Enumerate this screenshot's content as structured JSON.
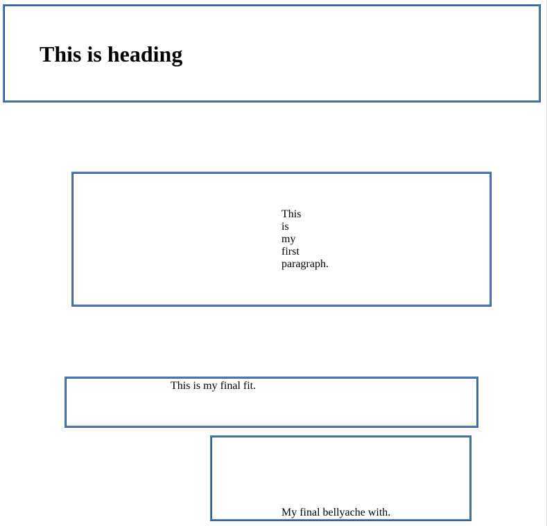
{
  "heading": {
    "text": "This is heading"
  },
  "paragraph": {
    "text": "This is my first paragraph."
  },
  "fit": {
    "text": "This is my final fit."
  },
  "bellyache": {
    "text": "My final bellyache with."
  },
  "colors": {
    "border": "#4a7fc8",
    "background": "#ffffff",
    "text": "#000000"
  }
}
